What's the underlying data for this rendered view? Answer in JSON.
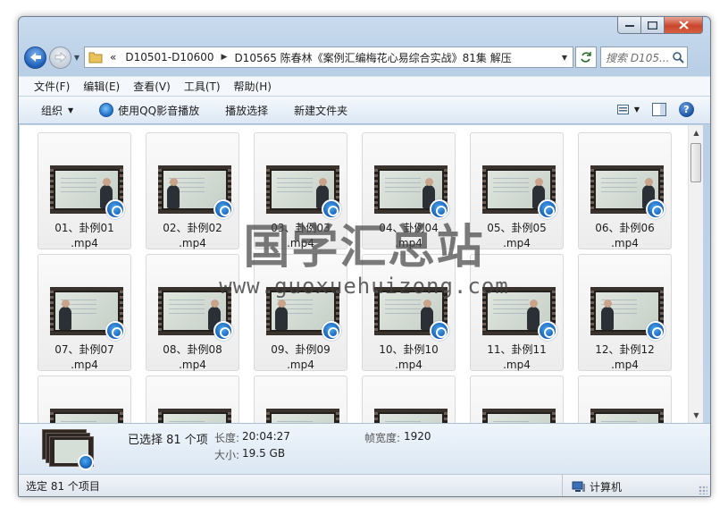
{
  "window": {
    "breadcrumb": [
      "D10501-D10600",
      "D10565 陈春林《案例汇编梅花心易综合实战》81集 解压"
    ],
    "breadcrumb_prefix": "«",
    "search_placeholder": "搜索 D105..."
  },
  "menu": [
    "文件(F)",
    "编辑(E)",
    "查看(V)",
    "工具(T)",
    "帮助(H)"
  ],
  "toolbar": {
    "organize": "组织",
    "play_qq": "使用QQ影音播放",
    "playlist": "播放选择",
    "new_folder": "新建文件夹"
  },
  "files": [
    {
      "name": "01、卦例01",
      "ext": ".mp4"
    },
    {
      "name": "02、卦例02",
      "ext": ".mp4"
    },
    {
      "name": "03、卦例03",
      "ext": ".mp4"
    },
    {
      "name": "04、卦例04",
      "ext": ".mp4"
    },
    {
      "name": "05、卦例05",
      "ext": ".mp4"
    },
    {
      "name": "06、卦例06",
      "ext": ".mp4"
    },
    {
      "name": "07、卦例07",
      "ext": ".mp4"
    },
    {
      "name": "08、卦例08",
      "ext": ".mp4"
    },
    {
      "name": "09、卦例09",
      "ext": ".mp4"
    },
    {
      "name": "10、卦例10",
      "ext": ".mp4"
    },
    {
      "name": "11、卦例11",
      "ext": ".mp4"
    },
    {
      "name": "12、卦例12",
      "ext": ".mp4"
    }
  ],
  "details": {
    "selected": "已选择 81 个项",
    "length_label": "长度:",
    "length_value": "20:04:27",
    "size_label": "大小:",
    "size_value": "19.5 GB",
    "frame_width_label": "帧宽度:",
    "frame_width_value": "1920"
  },
  "status": {
    "left": "选定 81 个项目",
    "right": "计算机"
  },
  "watermark": {
    "title": "国学汇总站",
    "url": "www.guoxuehuizong.com"
  },
  "colors": {
    "accent": "#1d5fb8",
    "close": "#c8452d"
  }
}
